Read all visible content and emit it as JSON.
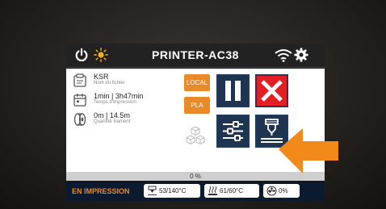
{
  "header": {
    "title": "PRINTER-AC38",
    "icons": [
      "power-icon",
      "sun-icon",
      "wifi-icon",
      "gear-icon"
    ]
  },
  "job": {
    "file_name": "KSR",
    "file_name_label": "Nom du fichier",
    "print_time": "1min | 3h47min",
    "print_time_label": "Temps d'impression",
    "filament": "0m | 14.5m",
    "filament_label": "Quantité filament"
  },
  "tags": {
    "source": "LOCAL",
    "material": "PLA"
  },
  "controls": [
    "pause",
    "stop",
    "tune",
    "extruder"
  ],
  "progress": {
    "value": 0,
    "label": "0 %"
  },
  "status": {
    "state": "EN IMPRESSION",
    "nozzle_temp": "53/140°C",
    "bed_temp": "61/60°C",
    "fan": "0%"
  },
  "colors": {
    "accent": "#e88a2a",
    "button_blue": "#1e3450",
    "stop_red": "#e31e24",
    "status_bg": "#0b1a2e"
  }
}
